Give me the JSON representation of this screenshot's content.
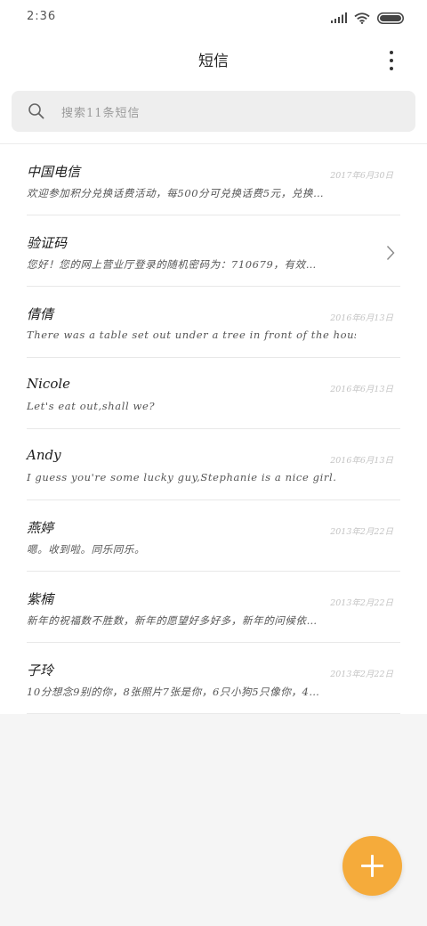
{
  "status_bar": {
    "time": "2:36"
  },
  "header": {
    "title": "短信"
  },
  "search": {
    "placeholder": "搜索11条短信"
  },
  "conversations": [
    {
      "name": "中国电信",
      "date": "2017年6月30日",
      "preview": "欢迎参加积分兑换话费活动，每500分可兑换话费5元，兑换…"
    },
    {
      "name": "验证码",
      "date": "",
      "preview": "您好！您的网上营业厅登录的随机密码为：710679，有效…"
    },
    {
      "name": "倩倩",
      "date": "2016年6月13日",
      "preview": "There was a table set out under a tree in front of the hous"
    },
    {
      "name": "Nicole",
      "date": "2016年6月13日",
      "preview": "Let's eat out,shall we?"
    },
    {
      "name": "Andy",
      "date": "2016年6月13日",
      "preview": "I guess you're some lucky guy,Stephanie is a nice girl."
    },
    {
      "name": "燕婷",
      "date": "2013年2月22日",
      "preview": "嗯。收到啦。同乐同乐。"
    },
    {
      "name": "紫楠",
      "date": "2013年2月22日",
      "preview": "新年的祝福数不胜数，新年的愿望好多好多，新年的问候依…"
    },
    {
      "name": "子玲",
      "date": "2013年2月22日",
      "preview": "10分想念9别的你，8张照片7张是你，6只小狗5只像你，4…"
    }
  ],
  "icons": {
    "signal": "signal-icon",
    "wifi": "wifi-icon",
    "battery": "battery-icon",
    "more": "more-vertical-icon",
    "search": "search-icon",
    "chevron": "chevron-right-icon",
    "compose": "plus-icon"
  },
  "colors": {
    "accent": "#f5ab3b"
  }
}
